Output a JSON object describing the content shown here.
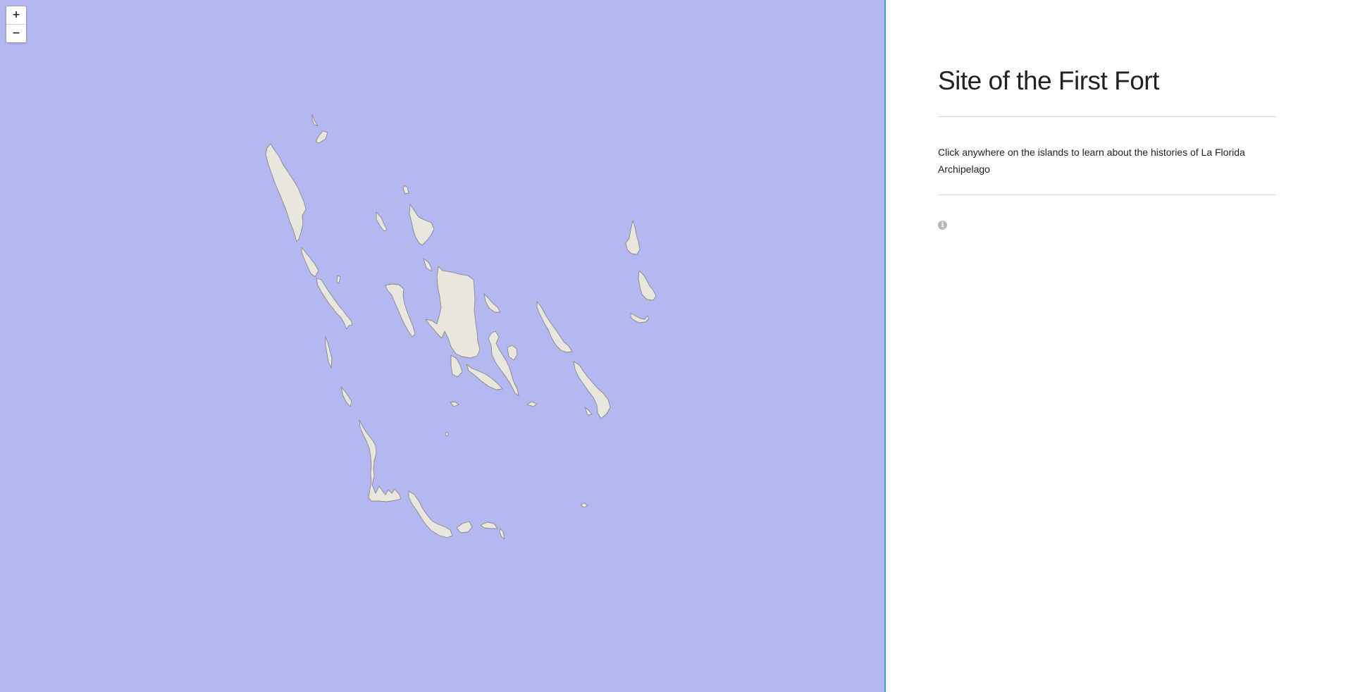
{
  "map": {
    "zoom_in_label": "+",
    "zoom_out_label": "−",
    "water_color": "#b2b7ef",
    "land_color": "#e8e6df",
    "divider_color": "#3aa3b5"
  },
  "sidebar": {
    "title": "Site of the First Fort",
    "intro": "Click anywhere on the islands to learn about the histories of La Florida Archipelago",
    "info_icon": "info-circle-icon"
  }
}
